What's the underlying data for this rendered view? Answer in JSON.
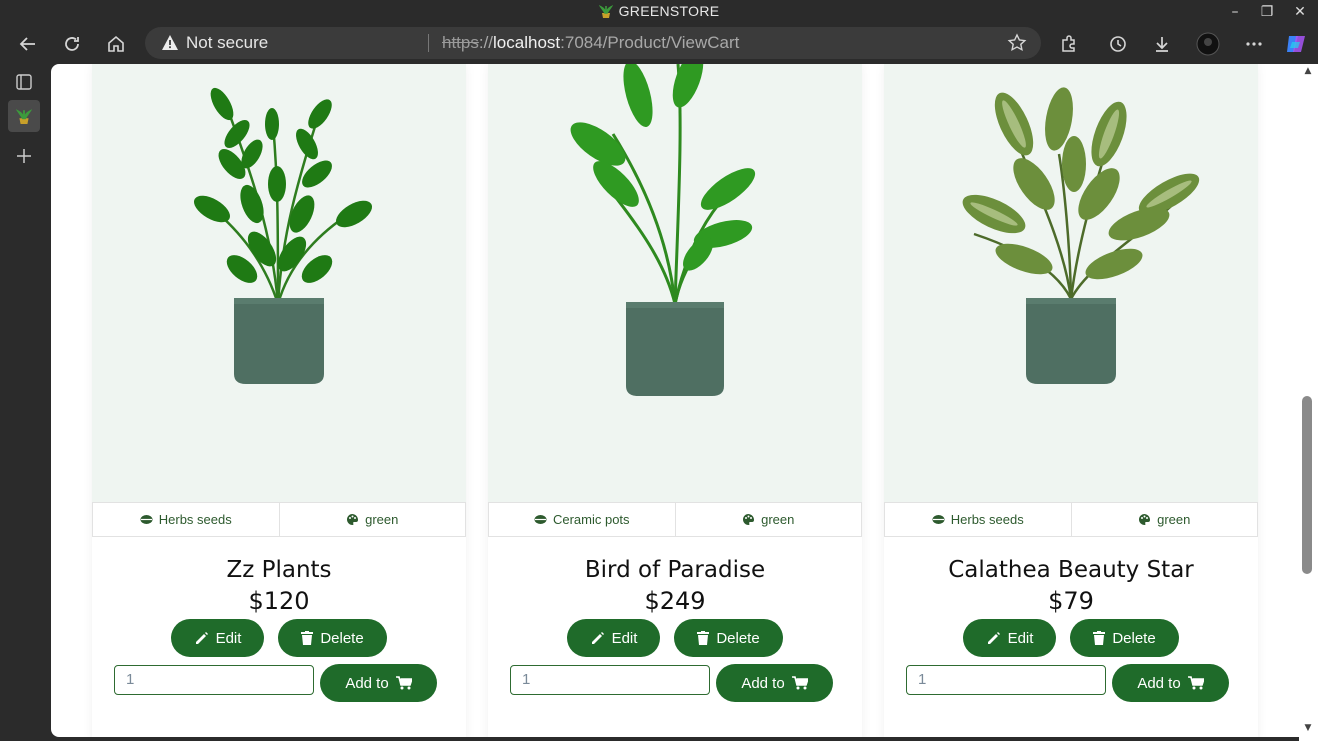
{
  "window": {
    "title": "GREENSTORE"
  },
  "address_bar": {
    "security_label": "Not secure",
    "url_scheme": "https",
    "url_separator": "://",
    "url_host": "localhost",
    "url_rest": ":7084/Product/ViewCart"
  },
  "products": [
    {
      "name": "Zz Plants",
      "price": "$120",
      "category": "Herbs seeds",
      "color": "green",
      "quantity": "1",
      "edit_label": "Edit",
      "delete_label": "Delete",
      "add_label": "Add to"
    },
    {
      "name": "Bird of Paradise",
      "price": "$249",
      "category": "Ceramic pots",
      "color": "green",
      "quantity": "1",
      "edit_label": "Edit",
      "delete_label": "Delete",
      "add_label": "Add to"
    },
    {
      "name": "Calathea Beauty Star",
      "price": "$79",
      "category": "Herbs seeds",
      "color": "green",
      "quantity": "1",
      "edit_label": "Edit",
      "delete_label": "Delete",
      "add_label": "Add to"
    }
  ],
  "colors": {
    "accent": "#1f6b2a",
    "image_bg": "#eff5f1",
    "pot": "#4f6f62"
  },
  "icons": [
    "back-icon",
    "refresh-icon",
    "home-icon",
    "warning-icon",
    "star-icon",
    "extensions-icon",
    "history-icon",
    "download-icon",
    "profile-icon",
    "more-icon",
    "copilot-icon",
    "pencil-icon",
    "trash-icon",
    "cart-icon",
    "palette-icon",
    "seed-icon"
  ]
}
